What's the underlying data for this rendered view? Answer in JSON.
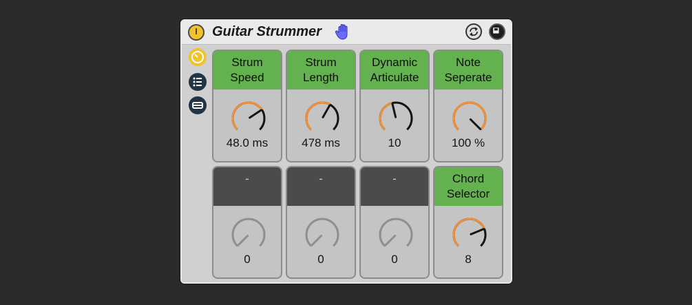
{
  "device": {
    "title": "Guitar Strummer",
    "icons": {
      "power": "power-icon",
      "hand": "hand-icon",
      "hot_swap": "hot-swap-icon",
      "save": "save-preset-icon",
      "macro": "macro-mapping-icon",
      "list": "list-icon",
      "chain": "chain-icon"
    }
  },
  "colors": {
    "accent_orange": "#f0913a",
    "header_green": "#64b14f",
    "header_inactive": "#4b4b4b",
    "dial_dark": "#151515",
    "dial_inactive": "#8f8f8f"
  },
  "macros": [
    {
      "line1": "Strum",
      "line2": "Speed",
      "value": "48.0 ms",
      "level": 0.71,
      "active": true
    },
    {
      "line1": "Strum",
      "line2": "Length",
      "value": "478 ms",
      "level": 0.61,
      "active": true
    },
    {
      "line1": "Dynamic",
      "line2": "Articulate",
      "value": "10",
      "level": 0.45,
      "active": true
    },
    {
      "line1": "Note",
      "line2": "Seperate",
      "value": "100 %",
      "level": 1.0,
      "active": true
    },
    {
      "line1": "-",
      "line2": "",
      "value": "0",
      "level": 0.0,
      "active": false
    },
    {
      "line1": "-",
      "line2": "",
      "value": "0",
      "level": 0.0,
      "active": false
    },
    {
      "line1": "-",
      "line2": "",
      "value": "0",
      "level": 0.0,
      "active": false
    },
    {
      "line1": "Chord",
      "line2": "Selector",
      "value": "8",
      "level": 0.75,
      "active": true
    }
  ]
}
